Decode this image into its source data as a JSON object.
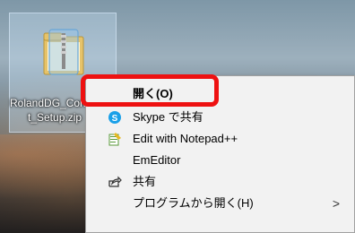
{
  "desktop": {
    "icon": {
      "label_line1": "RolandDG_Con",
      "label_line2": "t_Setup.zip",
      "icon_name": "zip-folder-icon"
    }
  },
  "context_menu": {
    "items": [
      {
        "label": "開く(O)",
        "icon": "",
        "default": true
      },
      {
        "label": "Skype で共有",
        "icon": "skype-icon"
      },
      {
        "label": "Edit with Notepad++",
        "icon": "notepad-plus-plus-icon"
      },
      {
        "label": "EmEditor",
        "icon": ""
      },
      {
        "label": "共有",
        "icon": "share-icon"
      },
      {
        "label": "プログラムから開く(H)",
        "icon": "",
        "submenu_arrow": ">"
      }
    ]
  },
  "colors": {
    "highlight_border": "#ee1111",
    "menu_bg": "#f2f2f2",
    "selection": "#cce4f7"
  }
}
